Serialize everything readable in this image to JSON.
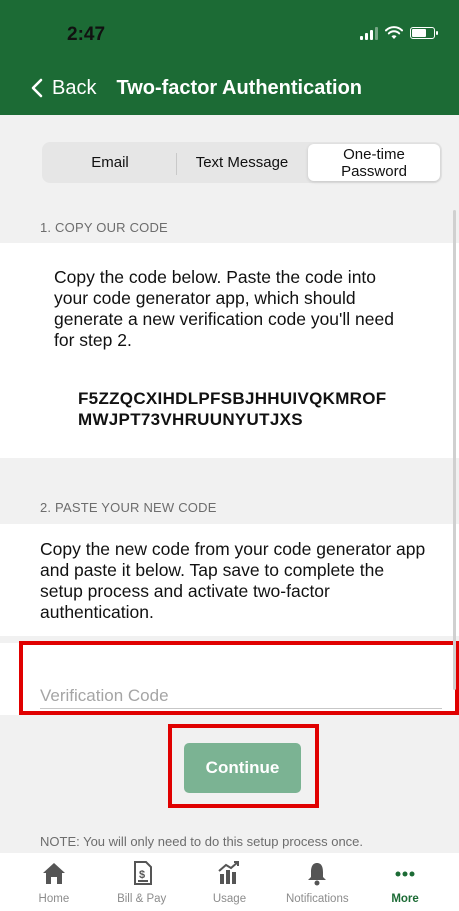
{
  "status_bar": {
    "time": "2:47"
  },
  "nav": {
    "back_label": "Back",
    "title": "Two-factor Authentication"
  },
  "segments": [
    {
      "label": "Email"
    },
    {
      "label": "Text Message"
    },
    {
      "label": "One-time\nPassword",
      "selected": true
    }
  ],
  "step1": {
    "header": "1. COPY OUR CODE",
    "text": "Copy the code below. Paste the code into your code generator app, which should generate a new verification code you'll need for step 2.",
    "code_line1": "F5ZZQCXIHDLPFSBJHHUIVQKMROF",
    "code_line2": "MWJPT73VHRUUNYUTJXS"
  },
  "step2": {
    "header": "2. PASTE YOUR NEW CODE",
    "text": "Copy the new code from your code generator app and paste it below. Tap save to complete the setup process and activate two-factor authentication."
  },
  "verification": {
    "placeholder": "Verification Code",
    "value": ""
  },
  "continue_label": "Continue",
  "note": "NOTE: You will only need to do this setup process once.",
  "tabs": [
    {
      "label": "Home",
      "icon": "home-icon"
    },
    {
      "label": "Bill & Pay",
      "icon": "bill-icon"
    },
    {
      "label": "Usage",
      "icon": "usage-chart-icon"
    },
    {
      "label": "Notifications",
      "icon": "bell-icon"
    },
    {
      "label": "More",
      "icon": "more-icon",
      "active": true
    }
  ],
  "colors": {
    "brand_green": "#1c6b35",
    "continue_disabled": "#7bb393",
    "highlight_red": "#e00000"
  }
}
